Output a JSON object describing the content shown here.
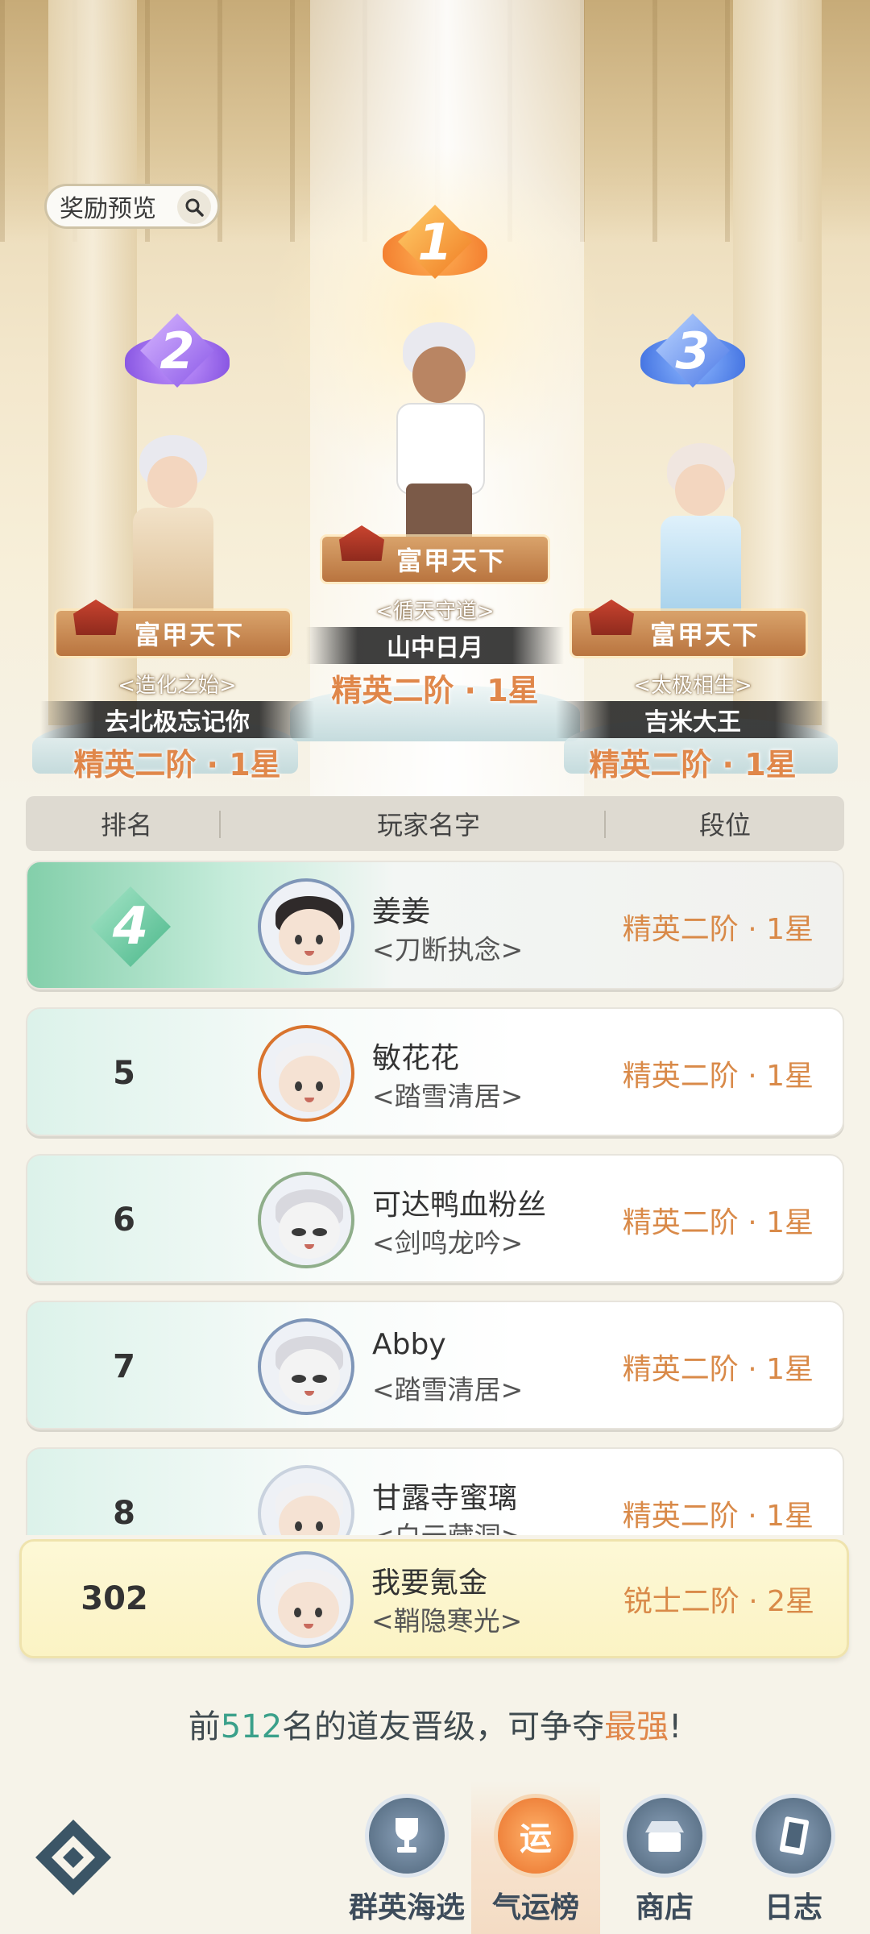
{
  "reward_preview": {
    "label": "奖励预览"
  },
  "podium": [
    {
      "rank": "1",
      "title": "富甲天下",
      "guild": "<循天守道>",
      "name": "山中日月",
      "tier": "精英二阶 · 1星"
    },
    {
      "rank": "2",
      "title": "富甲天下",
      "guild": "<造化之始>",
      "name": "去北极忘记你",
      "tier": "精英二阶 · 1星"
    },
    {
      "rank": "3",
      "title": "富甲天下",
      "guild": "<太极相生>",
      "name": "吉米大王",
      "tier": "精英二阶 · 1星"
    }
  ],
  "table_header": {
    "rank": "排名",
    "player": "玩家名字",
    "tier": "段位"
  },
  "rows": [
    {
      "rank": "4",
      "name": "姜姜",
      "guild": "<刀断执念>",
      "tier": "精英二阶 · 1星"
    },
    {
      "rank": "5",
      "name": "敏花花",
      "guild": "<踏雪清居>",
      "tier": "精英二阶 · 1星"
    },
    {
      "rank": "6",
      "name": "可达鸭血粉丝",
      "guild": "<剑鸣龙吟>",
      "tier": "精英二阶 · 1星"
    },
    {
      "rank": "7",
      "name": "Abby",
      "guild": "<踏雪清居>",
      "tier": "精英二阶 · 1星"
    },
    {
      "rank": "8",
      "name": "甘露寺蜜璃",
      "guild": "<白云藏洞>",
      "tier": "精英二阶 · 1星"
    }
  ],
  "self_row": {
    "rank": "302",
    "name": "我要氪金",
    "guild": "<鞘隐寒光>",
    "tier": "锐士二阶 · 2星"
  },
  "promo": {
    "before": "前",
    "count": "512",
    "middle": "名的道友晋级，可争夺",
    "highlight": "最强",
    "after": "!"
  },
  "nav": [
    {
      "label": "群英海选",
      "icon": "trophy-icon",
      "active": false
    },
    {
      "label": "气运榜",
      "icon": "fortune-icon",
      "active": true,
      "glyph": "运"
    },
    {
      "label": "商店",
      "icon": "shop-icon",
      "active": false
    },
    {
      "label": "日志",
      "icon": "log-book-icon",
      "active": false
    }
  ],
  "colors": {
    "accent_orange": "#e0874a",
    "accent_teal": "#3aa08a",
    "highlight_green": "#83cfaa"
  }
}
